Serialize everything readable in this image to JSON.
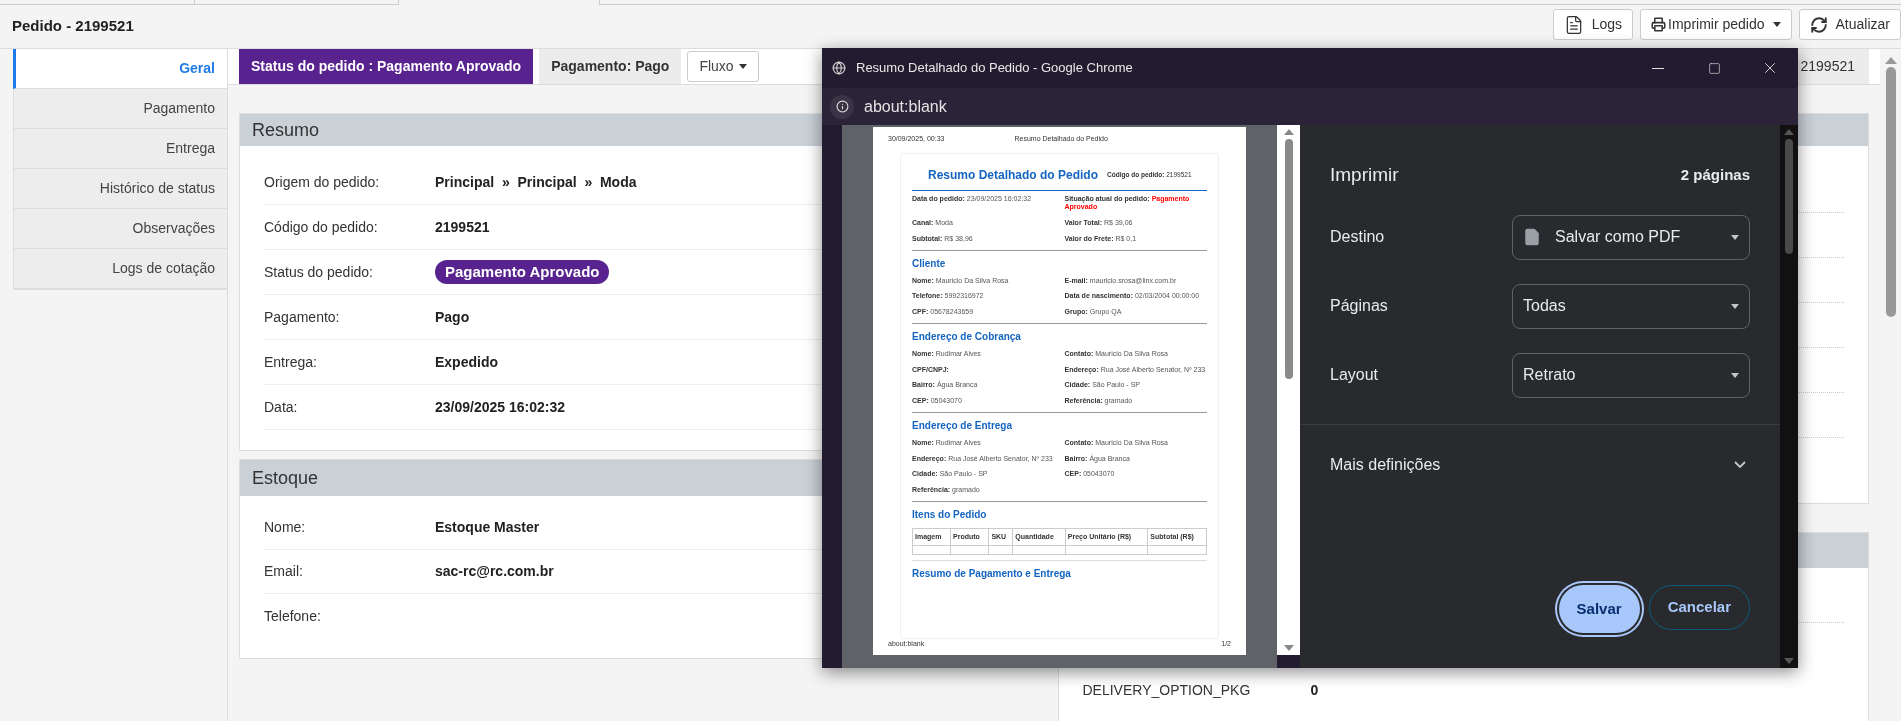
{
  "page": {
    "title": "Pedido - 2199521"
  },
  "toolbar": [
    {
      "kind": "logs",
      "label": "Logs"
    },
    {
      "kind": "print",
      "label": "Imprimir pedido"
    },
    {
      "kind": "refresh",
      "label": "Atualizar"
    }
  ],
  "sidebar": {
    "items": [
      {
        "label": "Geral",
        "selected": true
      },
      {
        "label": "Pagamento",
        "selected": false
      },
      {
        "label": "Entrega",
        "selected": false
      },
      {
        "label": "Histórico de status",
        "selected": false
      },
      {
        "label": "Observações",
        "selected": false
      },
      {
        "label": "Logs de cotação",
        "selected": false
      }
    ]
  },
  "status_bar": {
    "status": "Status do pedido : Pagamento Aprovado",
    "payment": "Pagamento: Pago",
    "flow": "Fluxo",
    "order_code": "2199521"
  },
  "resumo": {
    "title": "Resumo",
    "rows": [
      {
        "label": "Origem do pedido:",
        "value": "Principal  »  Principal  »  Moda",
        "kind": "text"
      },
      {
        "label": "Código do pedido:",
        "value": "2199521",
        "kind": "text"
      },
      {
        "label": "Status do pedido:",
        "value": "Pagamento Aprovado",
        "kind": "badge"
      },
      {
        "label": "Pagamento:",
        "value": "Pago",
        "kind": "text"
      },
      {
        "label": "Entrega:",
        "value": "Expedido",
        "kind": "text"
      },
      {
        "label": "Data:",
        "value": "23/09/2025 16:02:32",
        "kind": "text"
      }
    ]
  },
  "estoque": {
    "title": "Estoque",
    "rows": [
      {
        "label": "Nome:",
        "value": "Estoque Master"
      },
      {
        "label": "Email:",
        "value": "sac-rc@rc.com.br"
      },
      {
        "label": "Telefone:"
      }
    ]
  },
  "delivery_panel": {
    "rows": [
      {
        "label": "DELIVERY_OPTION_PKG",
        "value": "0"
      }
    ]
  },
  "print_window": {
    "title": "Resumo Detalhado do Pedido - Google Chrome",
    "url": "about:blank",
    "preview": {
      "header_date": "30/09/2025, 00:33",
      "header_title": "Resumo Detalhado do Pedido",
      "heading": "Resumo Detalhado do Pedido",
      "order_code_label": "Código do pedido:",
      "order_code": "2199521",
      "sections": [
        {
          "kind": "fields",
          "fields": [
            {
              "label": "Data do pedido:",
              "value": "23/09/2025 16:02:32",
              "alert": false
            },
            {
              "label": "Situação atual do pedido:",
              "value": "Pagamento Aprovado",
              "alert": true
            },
            {
              "label": "Canal:",
              "value": "Moda",
              "alert": false
            },
            {
              "label": "Valor Total:",
              "value": "R$ 39,06",
              "alert": false
            },
            {
              "label": "Subtotal:",
              "value": "R$ 38,96",
              "alert": false
            },
            {
              "label": "Valor do Frete:",
              "value": "R$ 0,1",
              "alert": false
            }
          ]
        },
        {
          "kind": "fields",
          "title": "Cliente",
          "fields": [
            {
              "label": "Nome:",
              "value": "Mauricio Da Silva Rosa",
              "alert": false
            },
            {
              "label": "E-mail:",
              "value": "mauricio.srosa@linx.com.br",
              "alert": false
            },
            {
              "label": "Telefone:",
              "value": "5992316972",
              "alert": false
            },
            {
              "label": "Data de nascimento:",
              "value": "02/03/2004 00:00:00",
              "alert": false
            },
            {
              "label": "CPF:",
              "value": "05678243659",
              "alert": false
            },
            {
              "label": "Grupo:",
              "value": "Grupo QA",
              "alert": false
            }
          ]
        },
        {
          "kind": "fields",
          "title": "Endereço de Cobrança",
          "fields": [
            {
              "label": "Nome:",
              "value": "Rudimar Alves",
              "alert": false
            },
            {
              "label": "Contato:",
              "value": "Mauricio Da Silva Rosa",
              "alert": false
            },
            {
              "label": "CPF/CNPJ:",
              "alert": false
            },
            {
              "label": "Endereço:",
              "value": "Rua José Alberto Senator, Nº 233",
              "alert": false
            },
            {
              "label": "Bairro:",
              "value": "Água Branca",
              "alert": false
            },
            {
              "label": "Cidade:",
              "value": "São Paulo - SP",
              "alert": false
            },
            {
              "label": "CEP:",
              "value": "05043070",
              "alert": false
            },
            {
              "label": "Referência:",
              "value": "gramado",
              "alert": false
            }
          ]
        },
        {
          "kind": "fields",
          "title": "Endereço de Entrega",
          "fields": [
            {
              "label": "Nome:",
              "value": "Rudimar Alves",
              "alert": false
            },
            {
              "label": "Contato:",
              "value": "Mauricio Da Silva Rosa",
              "alert": false
            },
            {
              "label": "Endereço:",
              "value": "Rua José Alberto Senator, Nº 233",
              "alert": false
            },
            {
              "label": "Bairro:",
              "value": "Água Branca",
              "alert": false
            },
            {
              "label": "Cidade:",
              "value": "São Paulo - SP",
              "alert": false
            },
            {
              "label": "CEP:",
              "value": "05043070",
              "alert": false
            },
            {
              "label": "Referência:",
              "value": "gramado",
              "alert": false
            }
          ]
        },
        {
          "kind": "table",
          "title": "Itens do Pedido",
          "columns": [
            "Imagem",
            "Produto",
            "SKU",
            "Quantidade",
            "Preço Unitário (R$)",
            "Subtotal (R$)"
          ]
        },
        {
          "kind": "title",
          "title": "Resumo de Pagamento e Entrega"
        }
      ],
      "footer_url": "about:blank",
      "footer_page": "1/2"
    },
    "settings": {
      "title": "Imprimir",
      "pages": "2 páginas",
      "options": [
        {
          "label": "Destino",
          "value": "Salvar como PDF",
          "kind": "pdf"
        },
        {
          "label": "Páginas",
          "value": "Todas",
          "kind": "plain"
        },
        {
          "label": "Layout",
          "value": "Retrato",
          "kind": "plain"
        }
      ],
      "more": "Mais definições",
      "buttons": [
        {
          "label": "Salvar",
          "primary": true
        },
        {
          "label": "Cancelar",
          "primary": false
        }
      ]
    }
  }
}
